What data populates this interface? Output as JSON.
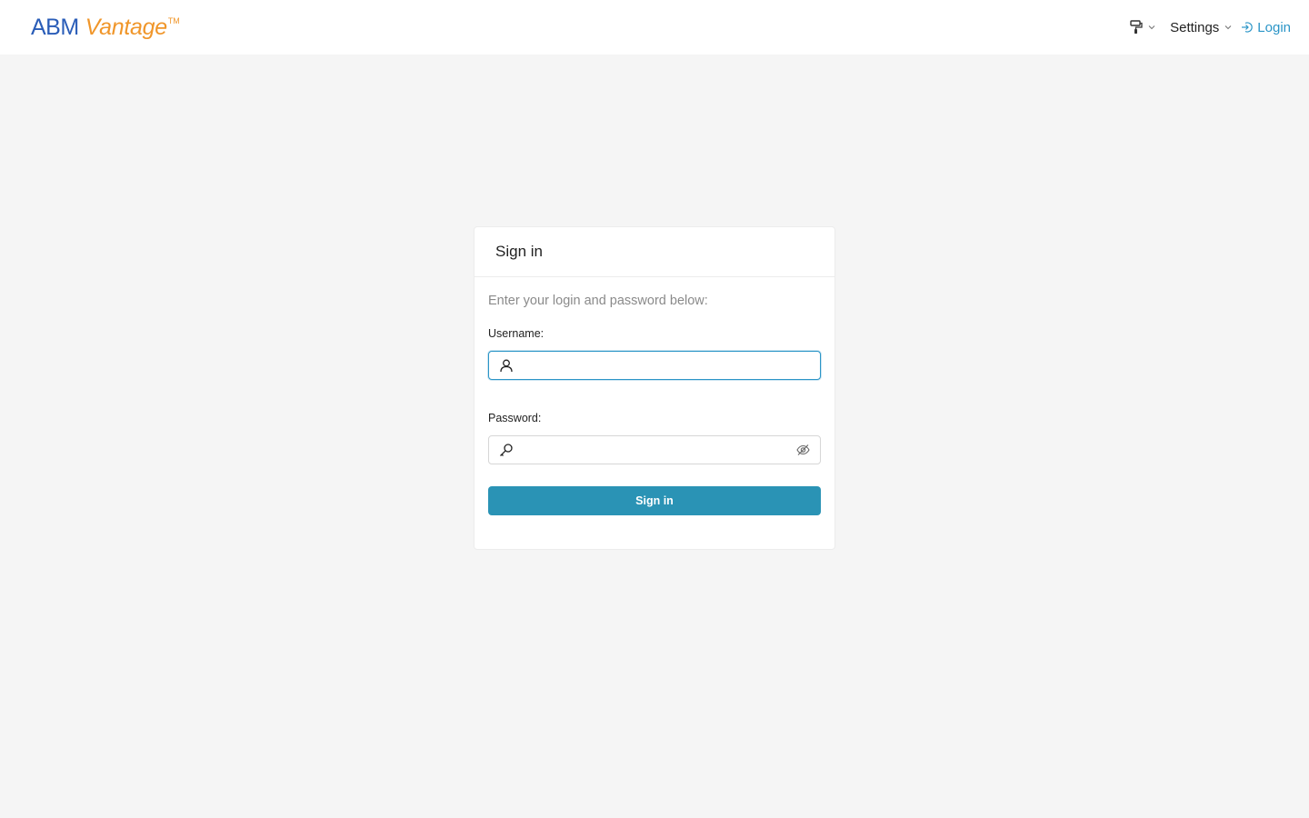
{
  "brand": {
    "primary": "ABM",
    "secondary": "Vantage",
    "trademark": "TM"
  },
  "nav": {
    "theme_icon": "paint-roller-icon",
    "settings_label": "Settings",
    "login_label": "Login"
  },
  "card": {
    "title": "Sign in",
    "subtitle": "Enter your login and password below:",
    "username_label": "Username:",
    "username_value": "",
    "password_label": "Password:",
    "password_value": "",
    "submit_label": "Sign in"
  },
  "colors": {
    "brand_blue": "#2a5db8",
    "brand_orange": "#f0962a",
    "accent": "#2b95c7",
    "button": "#2a93b5",
    "background": "#f5f5f5"
  }
}
